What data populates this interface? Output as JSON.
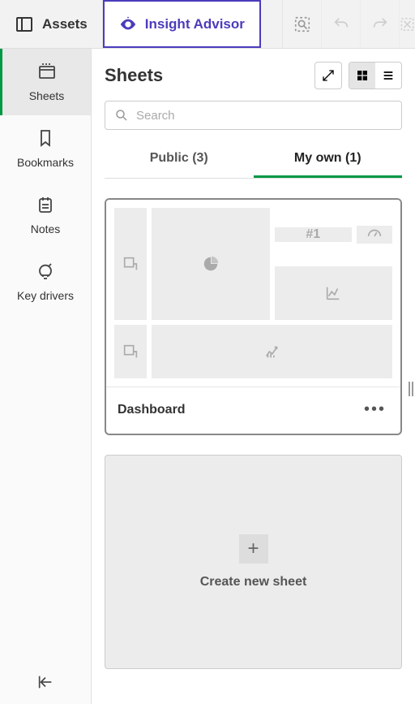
{
  "toolbar": {
    "assets_label": "Assets",
    "insight_label": "Insight Advisor"
  },
  "sidebar": {
    "items": [
      {
        "label": "Sheets"
      },
      {
        "label": "Bookmarks"
      },
      {
        "label": "Notes"
      },
      {
        "label": "Key drivers"
      }
    ]
  },
  "header": {
    "title": "Sheets"
  },
  "search": {
    "placeholder": "Search"
  },
  "tabs": {
    "public": {
      "label": "Public (3)",
      "count": 3
    },
    "myown": {
      "label": "My own (1)",
      "count": 1
    },
    "active": "myown"
  },
  "sheet_cards": [
    {
      "title": "Dashboard"
    }
  ],
  "create": {
    "label": "Create new sheet"
  }
}
